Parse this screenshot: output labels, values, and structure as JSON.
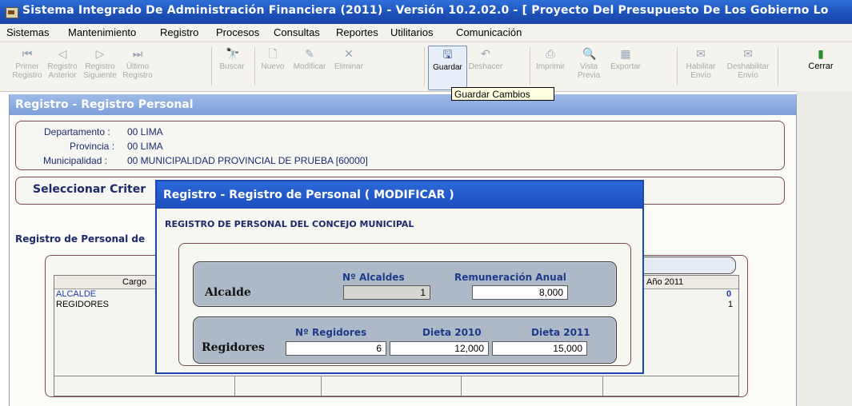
{
  "window": {
    "title": "Sistema Integrado De Administración Financiera (2011) - Versión 10.2.02.0 - [ Proyecto Del Presupuesto De Los Gobierno Lo"
  },
  "menu": [
    "Sistemas",
    "Mantenimiento",
    "Registro",
    "Procesos",
    "Consultas",
    "Reportes",
    "Utilitarios",
    "Comunicación"
  ],
  "toolbar": {
    "first": {
      "l1": "Primer",
      "l2": "Registro",
      "icon": "first-record-icon"
    },
    "prev": {
      "l1": "Registro",
      "l2": "Anterior",
      "icon": "previous-record-icon"
    },
    "next": {
      "l1": "Registro",
      "l2": "Siguiente",
      "icon": "next-record-icon"
    },
    "last": {
      "l1": "Último",
      "l2": "Registro",
      "icon": "last-record-icon"
    },
    "search": {
      "l1": "Buscar",
      "icon": "binoculars-icon"
    },
    "new": {
      "l1": "Nuevo",
      "icon": "new-document-icon"
    },
    "edit": {
      "l1": "Modificar",
      "icon": "edit-icon"
    },
    "delete": {
      "l1": "Eliminar",
      "icon": "delete-icon"
    },
    "save": {
      "l1": "Guardar",
      "icon": "save-icon"
    },
    "undo": {
      "l1": "Deshacer",
      "icon": "undo-icon"
    },
    "print": {
      "l1": "Imprimir",
      "icon": "printer-icon"
    },
    "preview": {
      "l1": "Vista",
      "l2": "Previa",
      "icon": "preview-icon"
    },
    "export": {
      "l1": "Exportar",
      "icon": "export-icon"
    },
    "enable_send": {
      "l1": "Habilitar",
      "l2": "Envío",
      "icon": "enable-send-icon"
    },
    "disable_send": {
      "l1": "Deshabilitar",
      "l2": "Envío",
      "icon": "disable-send-icon"
    },
    "close": {
      "l1": "Cerrar",
      "icon": "close-door-icon"
    }
  },
  "tooltip": "Guardar Cambios",
  "main": {
    "title": "Registro - Registro Personal",
    "departamento_label": "Departamento :",
    "departamento_value": "00  LIMA",
    "provincia_label": "Provincia :",
    "provincia_value": "00  LIMA",
    "municipalidad_label": "Municipalidad :",
    "municipalidad_value": "00  MUNICIPALIDAD PROVINCIAL DE PRUEBA [60000]",
    "criteria_label": "Seleccionar Criter",
    "registro_label": "Registro de Personal de",
    "grid": {
      "col_cargo": "Cargo",
      "col_year": "Año 2011",
      "rows": [
        {
          "cargo": "ALCALDE",
          "value": "0"
        },
        {
          "cargo": "REGIDORES",
          "value": "1"
        }
      ]
    }
  },
  "dialog": {
    "title": "Registro - Registro de Personal ( MODIFICAR )",
    "subtitle": "REGISTRO DE PERSONAL DEL CONCEJO MUNICIPAL",
    "alcalde": {
      "label": "Alcalde",
      "count_label": "Nº Alcaldes",
      "count_value": "1",
      "remuneracion_label": "Remuneración Anual",
      "remuneracion_value": "8,000"
    },
    "regidores": {
      "label": "Regidores",
      "count_label": "Nº Regidores",
      "count_value": "6",
      "dieta2010_label": "Dieta 2010",
      "dieta2010_value": "12,000",
      "dieta2011_label": "Dieta 2011",
      "dieta2011_value": "15,000"
    }
  }
}
